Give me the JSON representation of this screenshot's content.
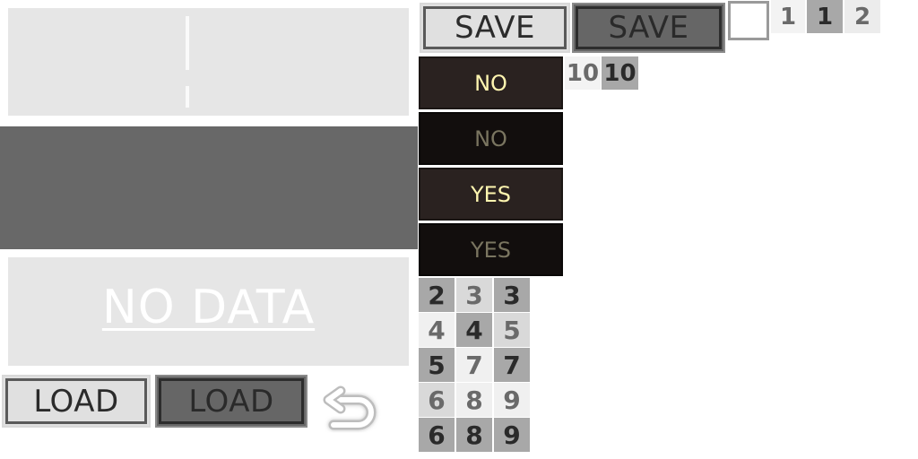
{
  "slots": {
    "empty_label": "NO DATA"
  },
  "buttons": {
    "save_label": "SAVE",
    "save_active_label": "SAVE",
    "load_label": "LOAD",
    "load_active_label": "LOAD"
  },
  "icons": {
    "back": "back-arrow-icon"
  },
  "pages": {
    "top": [
      "1",
      "1",
      "2"
    ],
    "secondary": [
      "10",
      "10"
    ]
  },
  "options": {
    "no_active": "NO",
    "no_inactive": "NO",
    "yes_active": "YES",
    "yes_inactive": "YES"
  },
  "number_grid": [
    [
      "2",
      "3",
      "3"
    ],
    [
      "4",
      "4",
      "5"
    ],
    [
      "5",
      "7",
      "7"
    ],
    [
      "6",
      "8",
      "9"
    ],
    [
      "6",
      "8",
      "9"
    ]
  ]
}
